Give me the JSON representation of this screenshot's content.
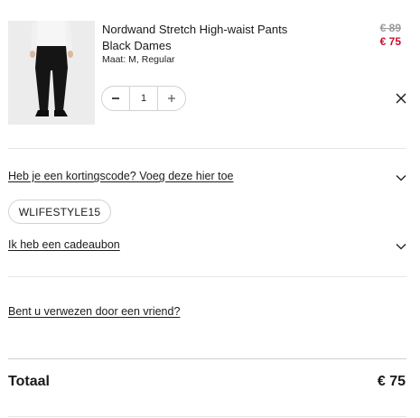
{
  "product": {
    "title": "Nordwand Stretch High-waist Pants Black Dames",
    "variant": "Maat: M, Regular",
    "price_old": "€ 89",
    "price_new": "€ 75",
    "quantity": "1",
    "image_icon": "pants-product-image"
  },
  "discount": {
    "link_text": "Heb je een kortingscode? Voeg deze hier toe",
    "applied_code": "WLIFESTYLE15"
  },
  "gift_card": {
    "link_text": "Ik heb een cadeaubon"
  },
  "referral": {
    "link_text": "Bent u verwezen door een vriend?"
  },
  "summary": {
    "total_label": "Totaal",
    "total_value": "€ 75"
  },
  "colors": {
    "sale_price": "#c8102e",
    "old_price": "#9a9a9a",
    "divider": "#e6e6e6"
  }
}
